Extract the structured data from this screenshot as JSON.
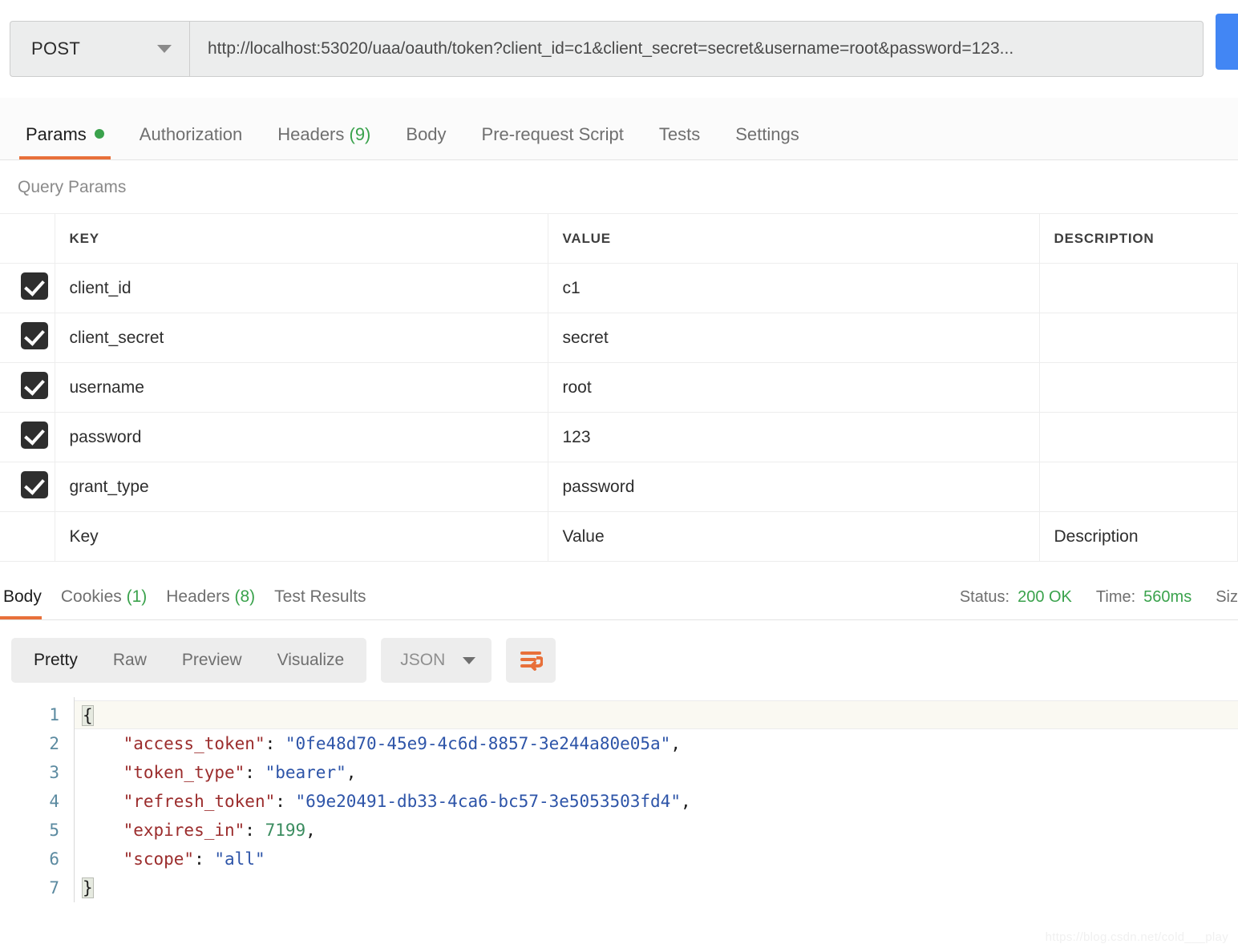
{
  "request": {
    "method": "POST",
    "url": "http://localhost:53020/uaa/oauth/token?client_id=c1&client_secret=secret&username=root&password=123...",
    "send_label": "",
    "tabs": [
      {
        "label": "Params",
        "badge": "",
        "active": true,
        "dot": true
      },
      {
        "label": "Authorization",
        "badge": "",
        "active": false,
        "dot": false
      },
      {
        "label": "Headers",
        "badge": "(9)",
        "active": false,
        "dot": false
      },
      {
        "label": "Body",
        "badge": "",
        "active": false,
        "dot": false
      },
      {
        "label": "Pre-request Script",
        "badge": "",
        "active": false,
        "dot": false
      },
      {
        "label": "Tests",
        "badge": "",
        "active": false,
        "dot": false
      },
      {
        "label": "Settings",
        "badge": "",
        "active": false,
        "dot": false
      }
    ]
  },
  "query_params": {
    "title": "Query Params",
    "headers": {
      "key": "KEY",
      "value": "VALUE",
      "description": "DESCRIPTION"
    },
    "rows": [
      {
        "checked": true,
        "key": "client_id",
        "value": "c1",
        "description": ""
      },
      {
        "checked": true,
        "key": "client_secret",
        "value": "secret",
        "description": ""
      },
      {
        "checked": true,
        "key": "username",
        "value": "root",
        "description": ""
      },
      {
        "checked": true,
        "key": "password",
        "value": "123",
        "description": ""
      },
      {
        "checked": true,
        "key": "grant_type",
        "value": "password",
        "description": ""
      }
    ],
    "placeholder_row": {
      "key": "Key",
      "value": "Value",
      "description": "Description"
    }
  },
  "response": {
    "tabs": [
      {
        "label": "Body",
        "badge": "",
        "active": true
      },
      {
        "label": "Cookies",
        "badge": "(1)",
        "active": false
      },
      {
        "label": "Headers",
        "badge": "(8)",
        "active": false
      },
      {
        "label": "Test Results",
        "badge": "",
        "active": false
      }
    ],
    "status_label": "Status:",
    "status_value": "200 OK",
    "time_label": "Time:",
    "time_value": "560ms",
    "size_label": "Siz",
    "toolbar": {
      "views": [
        {
          "label": "Pretty",
          "active": true
        },
        {
          "label": "Raw",
          "active": false
        },
        {
          "label": "Preview",
          "active": false
        },
        {
          "label": "Visualize",
          "active": false
        }
      ],
      "format": "JSON",
      "wrap_icon": "word-wrap-icon"
    },
    "line_numbers": [
      "1",
      "2",
      "3",
      "4",
      "5",
      "6",
      "7"
    ],
    "json": {
      "access_token": "0fe48d70-45e9-4c6d-8857-3e244a80e05a",
      "token_type": "bearer",
      "refresh_token": "69e20491-db33-4ca6-bc57-3e5053503fd4",
      "expires_in": "7199",
      "scope": "all"
    },
    "json_keys": {
      "access_token": "\"access_token\"",
      "token_type": "\"token_type\"",
      "refresh_token": "\"refresh_token\"",
      "expires_in": "\"expires_in\"",
      "scope": "\"scope\""
    },
    "json_values": {
      "access_token": "\"0fe48d70-45e9-4c6d-8857-3e244a80e05a\"",
      "token_type": "\"bearer\"",
      "refresh_token": "\"69e20491-db33-4ca6-bc57-3e5053503fd4\"",
      "expires_in": "7199",
      "scope": "\"all\""
    },
    "brace_open": "{",
    "brace_close": "}"
  },
  "watermark": "https://blog.csdn.net/cold___play",
  "colors": {
    "accent": "#e8703a",
    "success": "#3aa24c",
    "send": "#4286f4",
    "json_key": "#9b2c2c",
    "json_string": "#2d54a8",
    "json_number": "#3a8c5f"
  }
}
